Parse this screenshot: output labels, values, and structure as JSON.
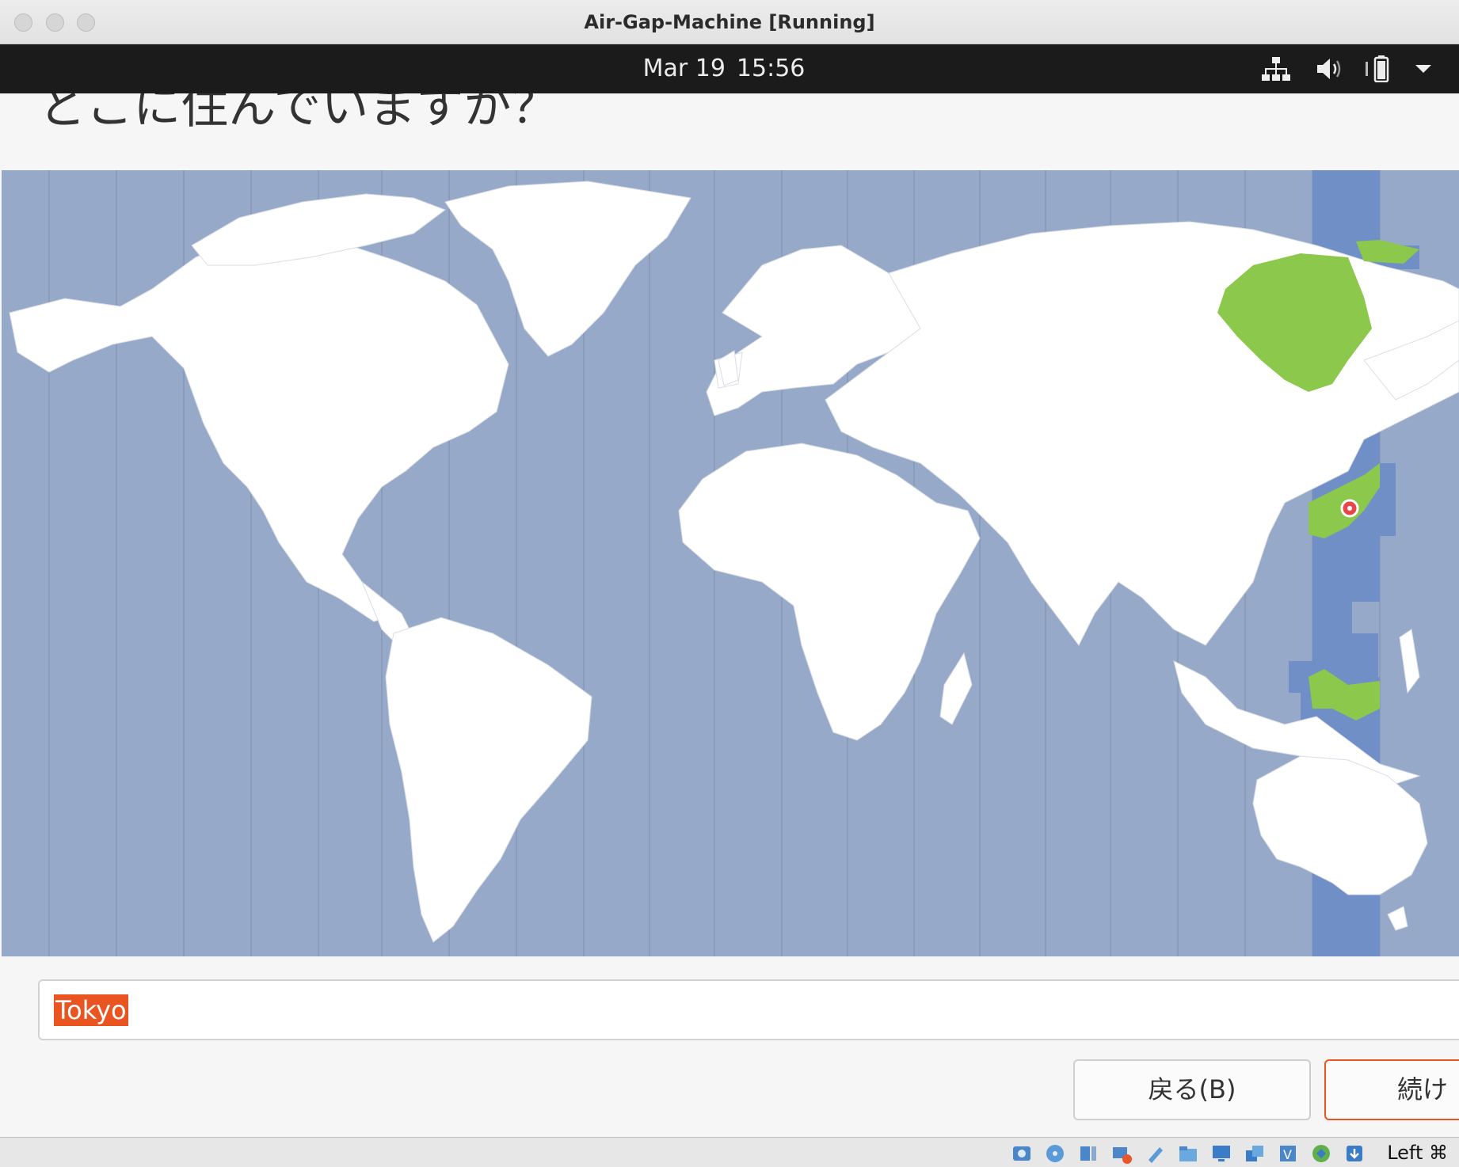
{
  "window": {
    "title": "Air-Gap-Machine [Running]"
  },
  "topbar": {
    "date": "Mar 19",
    "time": "15:56"
  },
  "installer": {
    "heading": "どこに住んでいますか？",
    "timezone_input_value": "Tokyo",
    "back_button_label": "戻る(B)",
    "continue_button_label": "続け",
    "selected_city": "Tokyo"
  },
  "statusbar": {
    "host_key_label": "Left ⌘"
  },
  "colors": {
    "ocean": "#96a9c9",
    "land": "#ffffff",
    "selected_zone": "#6f8fc6",
    "selected_land": "#8cc84b",
    "accent": "#e95420",
    "marker": "#e8474a"
  },
  "icons": [
    "network-icon",
    "volume-icon",
    "battery-icon",
    "menu-dropdown-icon"
  ]
}
